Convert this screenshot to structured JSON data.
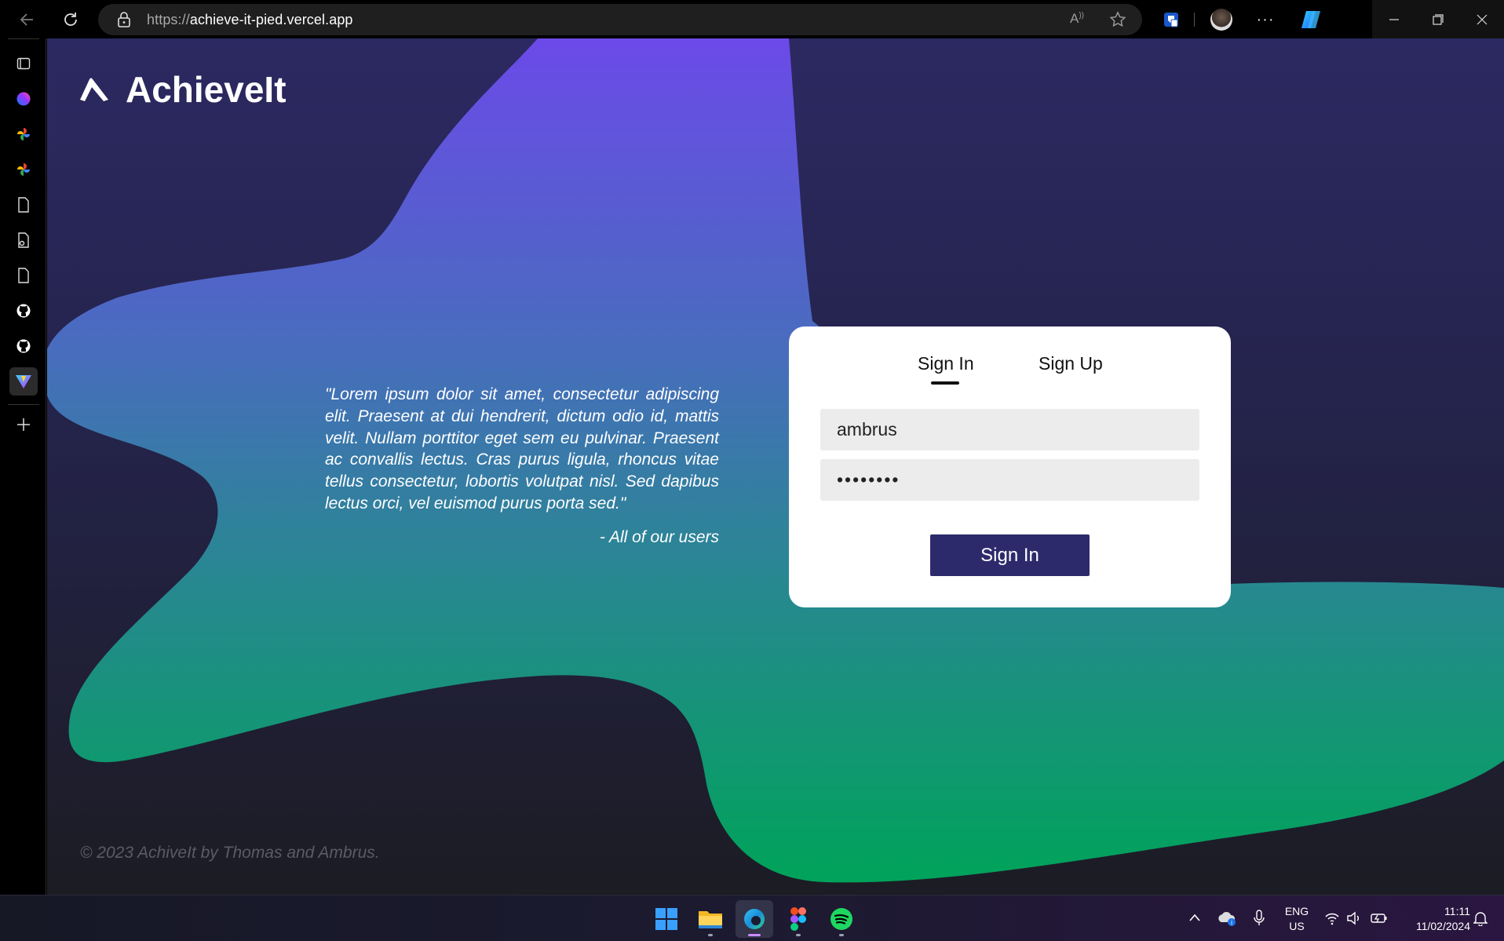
{
  "browser": {
    "url_protocol": "https://",
    "url_host": "achieve-it-pied.vercel.app"
  },
  "page": {
    "brand": "AchieveIt",
    "quote": "\"Lorem ipsum dolor sit amet, consectetur adipiscing elit. Praesent at dui hendrerit, dictum odio id, mattis velit. Nullam porttitor eget sem eu pulvinar. Praesent ac convallis lectus. Cras purus ligula, rhoncus vitae tellus consectetur, lobortis volutpat nisl. Sed dapibus lectus orci, vel euismod purus porta sed.\"",
    "quote_author": "- All of our users",
    "footer": "© 2023 AchivеIt by Thomas and Ambrus."
  },
  "auth": {
    "tab_signin": "Sign In",
    "tab_signup": "Sign Up",
    "active_tab": "signin",
    "username_value": "ambrus",
    "password_value": "ambrus12",
    "signin_button": "Sign In"
  },
  "taskbar": {
    "lang_line1": "ENG",
    "lang_line2": "US",
    "time": "11:11",
    "date": "11/02/2024"
  },
  "colors": {
    "button_bg": "#2d2a6c",
    "blob_top": "#6a4ae6",
    "blob_bottom": "#00a05a"
  }
}
